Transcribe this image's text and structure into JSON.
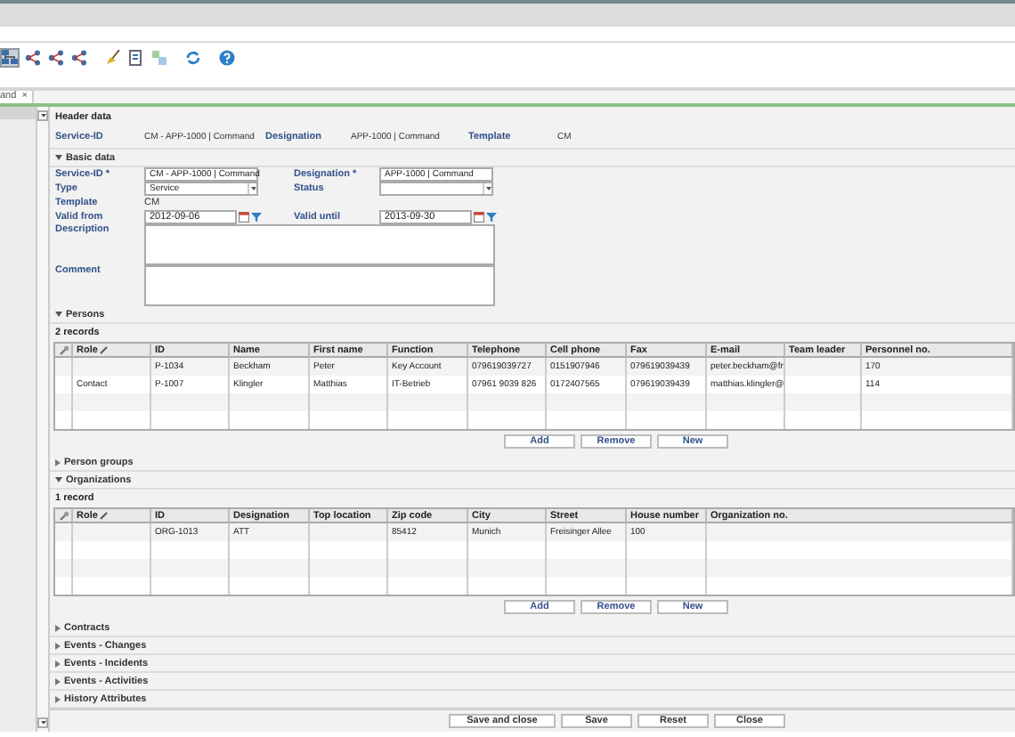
{
  "toolbar": [
    {
      "kind": "hierarchy",
      "selected": true
    },
    {
      "kind": "share",
      "selected": false
    },
    {
      "kind": "share",
      "selected": false
    },
    {
      "kind": "share",
      "selected": false
    },
    {
      "kind": "broom",
      "selected": false
    },
    {
      "kind": "document",
      "selected": false
    },
    {
      "kind": "cubes",
      "selected": false
    },
    {
      "kind": "refresh",
      "selected": false
    },
    {
      "kind": "help",
      "selected": false
    }
  ],
  "tab": {
    "label": "and",
    "close": "×"
  },
  "header_data": {
    "title": "Header data",
    "items": [
      {
        "label": "Service-ID",
        "value": "CM - APP-1000 | Command"
      },
      {
        "label": "Designation",
        "value": "APP-1000 | Command"
      },
      {
        "label": "Template",
        "value": "CM"
      }
    ]
  },
  "basic_data": {
    "title": "Basic data",
    "expanded": true,
    "rows": [
      {
        "fields": [
          {
            "kind": "text",
            "label": "Service-ID *",
            "value": "CM - APP-1000 | Command"
          },
          {
            "kind": "text",
            "label": "Designation *",
            "value": "APP-1000 | Command"
          }
        ]
      },
      {
        "fields": [
          {
            "kind": "select",
            "label": "Type",
            "value": "Service"
          },
          {
            "kind": "select",
            "label": "Status"
          }
        ]
      },
      {
        "fields": [
          {
            "kind": "static",
            "label": "Template",
            "value": "CM"
          }
        ]
      },
      {
        "fields": [
          {
            "kind": "date",
            "label": "Valid from",
            "value": "2012-09-06"
          },
          {
            "kind": "date",
            "label": "Valid until",
            "value": "2013-09-30"
          }
        ]
      },
      {
        "fields": [
          {
            "kind": "textarea",
            "label": "Description"
          }
        ]
      },
      {
        "fields": [
          {
            "kind": "textarea",
            "label": "Comment"
          }
        ]
      }
    ]
  },
  "persons": {
    "title": "Persons",
    "expanded": true,
    "count": "2 records",
    "columns": [
      "Role",
      "ID",
      "Name",
      "First name",
      "Function",
      "Telephone",
      "Cell phone",
      "Fax",
      "E-mail",
      "Team leader",
      "Personnel no."
    ],
    "rows": [
      [
        "",
        "P-1034",
        "Beckham",
        "Peter",
        "Key Account",
        "079619039727",
        "0151907946",
        "079619039439",
        "peter.beckham@fr",
        "",
        "170"
      ],
      [
        "Contact",
        "P-1007",
        "Klingler",
        "Matthias",
        "IT-Betrieb",
        "07961 9039 826",
        "0172407565",
        "079619039439",
        "matthias.klingler@",
        "",
        "114"
      ]
    ],
    "buttons": [
      "Add",
      "Remove",
      "New"
    ]
  },
  "person_groups": {
    "title": "Person groups",
    "expanded": false
  },
  "organizations": {
    "title": "Organizations",
    "expanded": true,
    "count": "1 record",
    "columns": [
      "Role",
      "ID",
      "Designation",
      "Top location",
      "Zip code",
      "City",
      "Street",
      "House number",
      "Organization no."
    ],
    "rows": [
      [
        "",
        "ORG-1013",
        "ATT",
        "",
        "85412",
        "Munich",
        "Freisinger Allee",
        "100",
        ""
      ]
    ],
    "buttons": [
      "Add",
      "Remove",
      "New"
    ]
  },
  "collapsed_sections": [
    {
      "title": "Contracts",
      "expanded": false
    },
    {
      "title": "Events - Changes",
      "expanded": false
    },
    {
      "title": "Events - Incidents",
      "expanded": false
    },
    {
      "title": "Events - Activities",
      "expanded": false
    },
    {
      "title": "History Attributes",
      "expanded": false
    }
  ],
  "footer_buttons": [
    "Save and close",
    "Save",
    "Reset",
    "Close"
  ]
}
